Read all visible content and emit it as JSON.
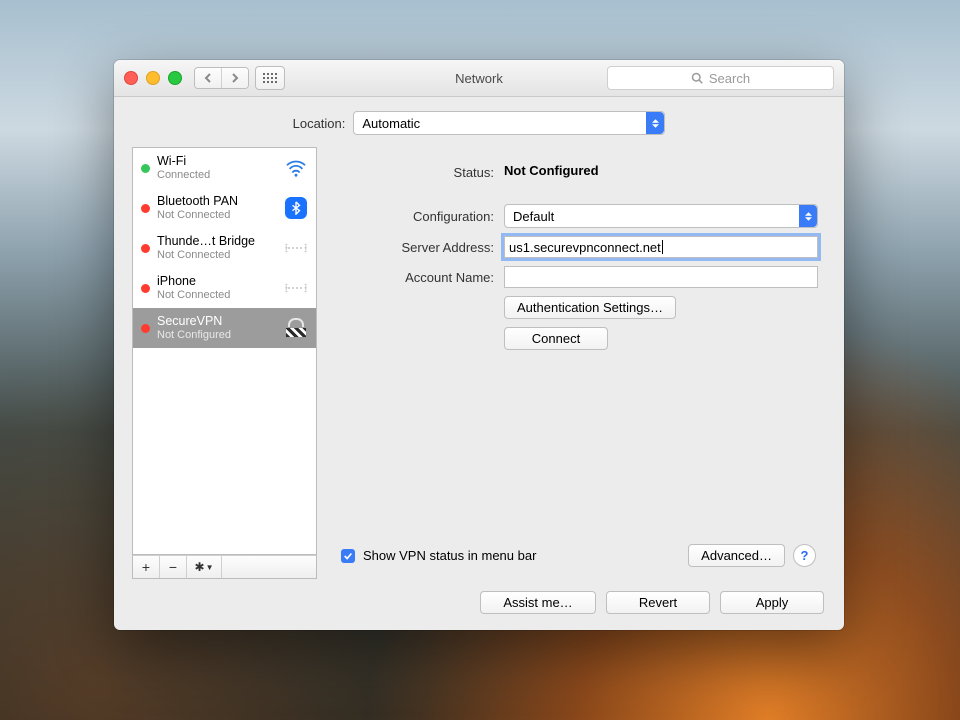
{
  "window": {
    "title": "Network"
  },
  "toolbar": {
    "search_placeholder": "Search"
  },
  "location": {
    "label": "Location:",
    "value": "Automatic"
  },
  "sidebar": {
    "items": [
      {
        "name": "Wi-Fi",
        "status": "Connected",
        "dot": "green",
        "icon": "wifi"
      },
      {
        "name": "Bluetooth PAN",
        "status": "Not Connected",
        "dot": "red",
        "icon": "bluetooth"
      },
      {
        "name": "Thunde…t Bridge",
        "status": "Not Connected",
        "dot": "red",
        "icon": "thunderbolt-bridge"
      },
      {
        "name": "iPhone",
        "status": "Not Connected",
        "dot": "red",
        "icon": "thunderbolt-bridge"
      },
      {
        "name": "SecureVPN",
        "status": "Not Configured",
        "dot": "red",
        "icon": "vpn-lock",
        "selected": true
      }
    ],
    "footer": {
      "add": "+",
      "remove": "−",
      "gear": "✻▾"
    }
  },
  "main": {
    "status_label": "Status:",
    "status_value": "Not Configured",
    "config_label": "Configuration:",
    "config_value": "Default",
    "server_label": "Server Address:",
    "server_value": "us1.securevpnconnect.net",
    "account_label": "Account Name:",
    "account_value": "",
    "auth_button": "Authentication Settings…",
    "connect_button": "Connect",
    "show_vpn_label": "Show VPN status in menu bar",
    "show_vpn_checked": true,
    "advanced_button": "Advanced…",
    "help": "?"
  },
  "footer": {
    "assist": "Assist me…",
    "revert": "Revert",
    "apply": "Apply"
  }
}
